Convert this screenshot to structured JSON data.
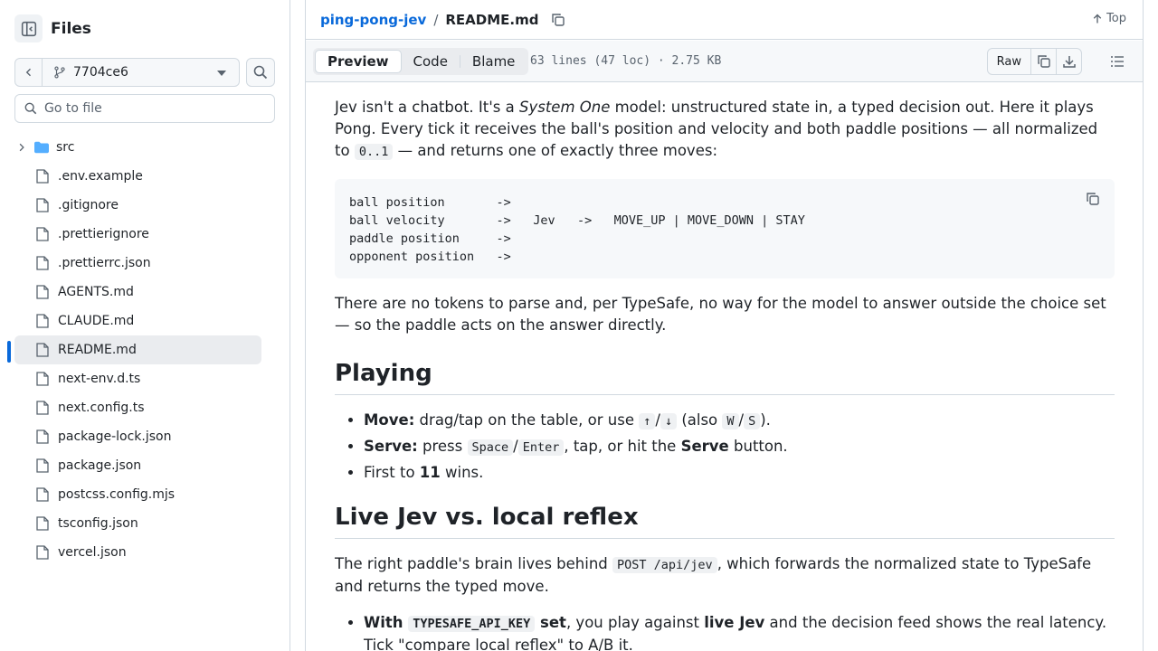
{
  "sidebar": {
    "title": "Files",
    "branch": "7704ce6",
    "goto_placeholder": "Go to file",
    "items": [
      {
        "label": "src",
        "type": "folder"
      },
      {
        "label": ".env.example",
        "type": "file"
      },
      {
        "label": ".gitignore",
        "type": "file"
      },
      {
        "label": ".prettierignore",
        "type": "file"
      },
      {
        "label": ".prettierrc.json",
        "type": "file"
      },
      {
        "label": "AGENTS.md",
        "type": "file"
      },
      {
        "label": "CLAUDE.md",
        "type": "file"
      },
      {
        "label": "README.md",
        "type": "file",
        "selected": true
      },
      {
        "label": "next-env.d.ts",
        "type": "file"
      },
      {
        "label": "next.config.ts",
        "type": "file"
      },
      {
        "label": "package-lock.json",
        "type": "file"
      },
      {
        "label": "package.json",
        "type": "file"
      },
      {
        "label": "postcss.config.mjs",
        "type": "file"
      },
      {
        "label": "tsconfig.json",
        "type": "file"
      },
      {
        "label": "vercel.json",
        "type": "file"
      }
    ]
  },
  "header": {
    "repo": "ping-pong-jev",
    "sep": "/",
    "file": "README.md",
    "top_label": "Top"
  },
  "toolbar": {
    "tabs": [
      "Preview",
      "Code",
      "Blame"
    ],
    "file_info": "63 lines (47 loc) · 2.75 KB",
    "raw_label": "Raw"
  },
  "readme": {
    "intro": {
      "t1": "Jev isn't a chatbot. It's a ",
      "em": "System One",
      "t2": " model: unstructured state in, a typed decision out. Here it plays Pong. Every tick it receives the ball's position and velocity and both paddle positions — all normalized to ",
      "code": "0..1",
      "t3": " — and returns one of exactly three moves:"
    },
    "code_lines": [
      "ball position       ->",
      "ball velocity       ->   Jev   ->   MOVE_UP | MOVE_DOWN | STAY",
      "paddle position     ->",
      "opponent position   ->"
    ],
    "para2": "There are no tokens to parse and, per TypeSafe, no way for the model to answer outside the choice set — so the paddle acts on the answer directly.",
    "h_playing": "Playing",
    "playing": {
      "move_label": "Move:",
      "move_t1": " drag/tap on the table, or use ",
      "move_up": "↑",
      "move_slash": "/",
      "move_down": "↓",
      "move_t2": " (also ",
      "move_w": "W",
      "move_slash2": "/",
      "move_s": "S",
      "move_t3": ").",
      "serve_label": "Serve:",
      "serve_t1": " press ",
      "serve_space": "Space",
      "serve_slash": "/",
      "serve_enter": "Enter",
      "serve_t2": ", tap, or hit the ",
      "serve_bold": "Serve",
      "serve_t3": " button.",
      "first_t1": "First to ",
      "first_bold": "11",
      "first_t2": " wins."
    },
    "h_live": "Live Jev vs. local reflex",
    "live": {
      "t1": "The right paddle's brain lives behind ",
      "code": "POST /api/jev",
      "t2": ", which forwards the normalized state to TypeSafe and returns the typed move."
    },
    "with": {
      "bold1": "With ",
      "code": "TYPESAFE_API_KEY",
      "bold2": " set",
      "t1": ", you play against ",
      "bold3": "live Jev",
      "t2": " and the decision feed shows the real latency. Tick \"compare local reflex\" to A/B it."
    }
  }
}
